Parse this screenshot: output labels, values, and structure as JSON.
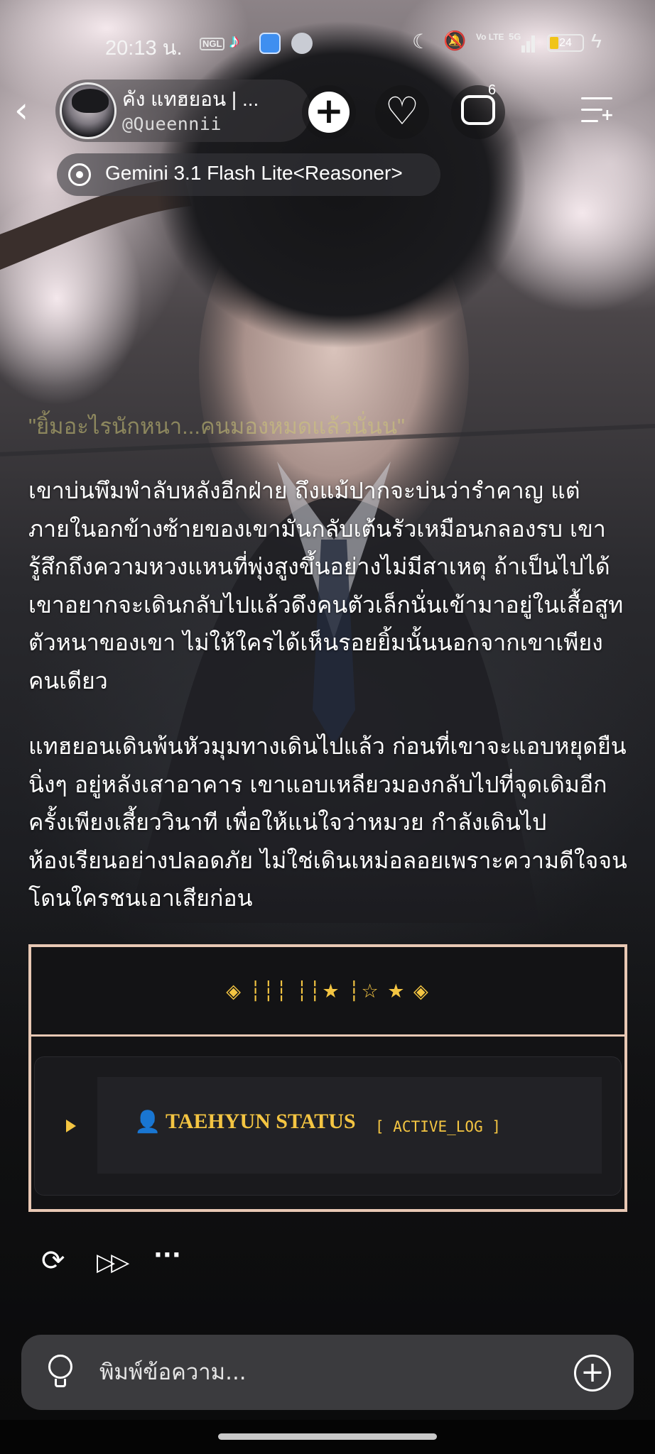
{
  "status_bar": {
    "time": "20:13 น.",
    "nfc": "NGL",
    "volte": "Vo LTE",
    "network": "5G",
    "battery": "24",
    "battery_fraction": 0.24,
    "icons": [
      "tiktok-icon",
      "app-icon",
      "app-icon",
      "moon-icon",
      "mute-icon",
      "volte-icon",
      "signal-icon",
      "battery-icon",
      "charging-icon"
    ]
  },
  "header": {
    "character_name": "คัง แทฮยอน | ...",
    "handle": "@Queennii",
    "comment_count": "6",
    "model_name": "Gemini 3.1 Flash Lite<Reasoner>"
  },
  "story": {
    "quote": "\"ยิ้มอะไรนักหนา...คนมองหมดแล้วนั่นน\"",
    "paragraphs": [
      "เขาบ่นพึมพำลับหลังอีกฝ่าย ถึงแม้ปากจะบ่นว่ารำคาญ แต่ภายในอกข้างซ้ายของเขามันกลับเต้นรัวเหมือนกลองรบ เขารู้สึกถึงความหวงแหนที่พุ่งสูงขึ้นอย่างไม่มีสาเหตุ ถ้าเป็นไปได้ เขาอยากจะเดินกลับไปแล้วดึงคนตัวเล็กนั่นเข้ามาอยู่ในเสื้อสูทตัวหนาของเขา ไม่ให้ใครได้เห็นรอยยิ้มนั้นนอกจากเขาเพียงคนเดียว",
      "แทฮยอนเดินพ้นหัวมุมทางเดินไปแล้ว ก่อนที่เขาจะแอบหยุดยืนนิ่งๆ อยู่หลังเสาอาคาร เขาแอบเหลียวมองกลับไปที่จุดเดิมอีกครั้งเพียงเสี้ยววินาที เพื่อให้แน่ใจว่าหมวย กำลังเดินไปห้องเรียนอย่างปลอดภัย ไม่ใช่เดินเหม่อลอยเพราะความดีใจจนโดนใครชนเอาเสียก่อน"
    ]
  },
  "status_card": {
    "decoration": "◈ ┆┆┆ ┆┆★ ┆☆ ★ ◈",
    "title": "TAEHYUN STATUS",
    "log_label": "[ ACTIVE_LOG ]",
    "accent_color": "#f4c542",
    "border_color": "#e8c8b4"
  },
  "input": {
    "placeholder": "พิมพ์ข้อความ..."
  }
}
